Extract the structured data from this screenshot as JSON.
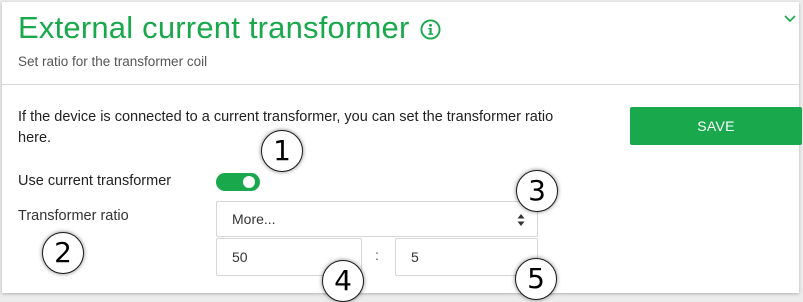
{
  "header": {
    "title": "External current transformer",
    "subtitle": "Set ratio for the transformer coil",
    "info_icon": "info-circle-icon",
    "collapse_icon": "chevron-down-icon"
  },
  "content": {
    "description": "If the device is connected to a current transformer, you can set the transformer ratio here.",
    "save_label": "SAVE",
    "use_transformer_label": "Use current transformer",
    "use_transformer_enabled": true,
    "ratio_label": "Transformer ratio",
    "ratio_select_value": "More...",
    "ratio_primary": "50",
    "ratio_separator": ":",
    "ratio_secondary": "5"
  },
  "callouts": [
    "1",
    "2",
    "3",
    "4",
    "5"
  ],
  "colors": {
    "accent": "#19a84c",
    "text": "#222222"
  }
}
